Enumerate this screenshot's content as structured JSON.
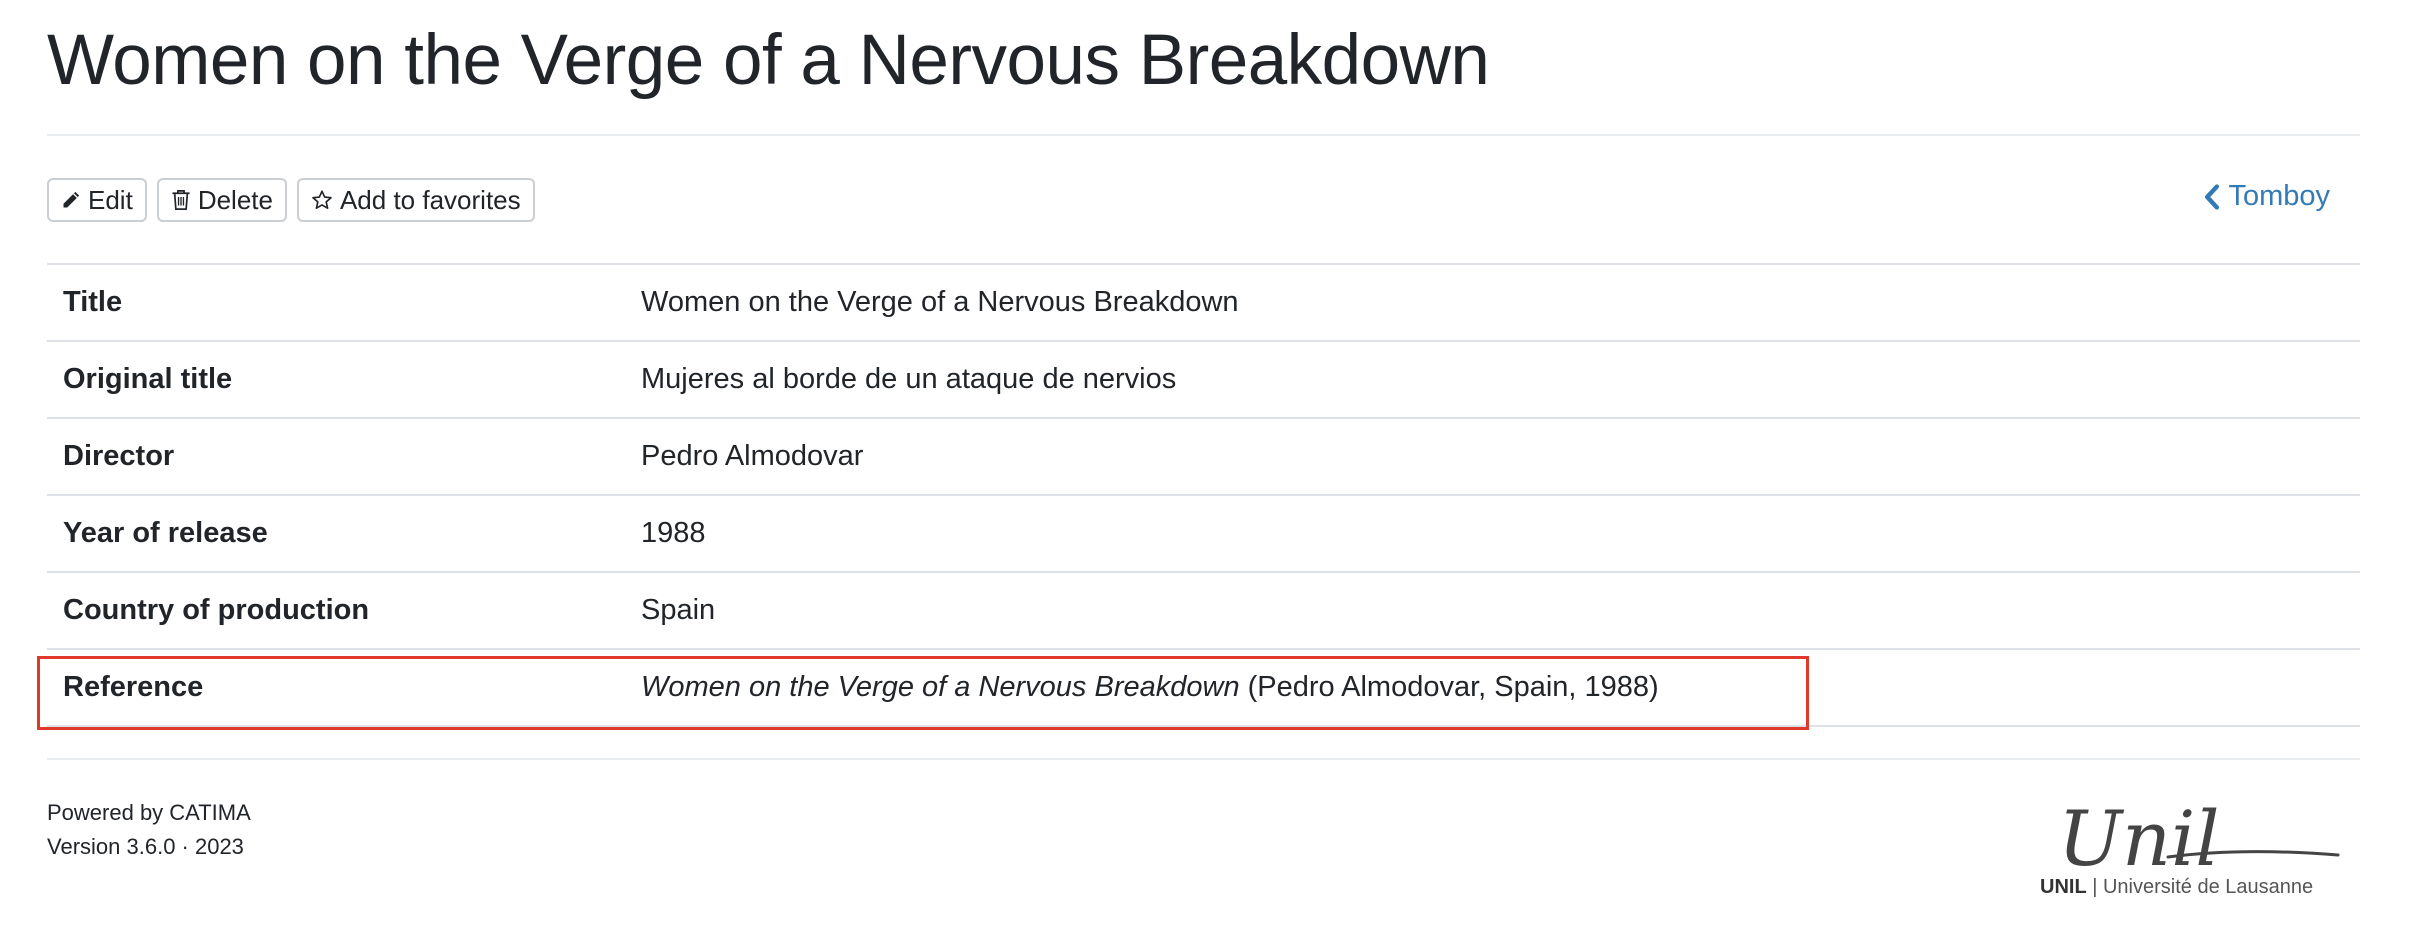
{
  "page": {
    "title": "Women on the Verge of a Nervous Breakdown"
  },
  "toolbar": {
    "edit_label": "Edit",
    "delete_label": "Delete",
    "favorites_label": "Add to favorites",
    "edit_icon": "pencil-icon",
    "delete_icon": "trash-icon",
    "favorites_icon": "star-icon"
  },
  "back_link": {
    "label": "Tomboy",
    "icon": "chevron-left-icon"
  },
  "details": [
    {
      "label": "Title",
      "value": "Women on the Verge of a Nervous Breakdown"
    },
    {
      "label": "Original title",
      "value": "Mujeres al borde de un ataque de nervios"
    },
    {
      "label": "Director",
      "value": "Pedro Almodovar"
    },
    {
      "label": "Year of release",
      "value": "1988"
    },
    {
      "label": "Country of production",
      "value": "Spain"
    }
  ],
  "reference": {
    "label": "Reference",
    "title_italic": "Women on the Verge of a Nervous Breakdown",
    "suffix": " (Pedro Almodovar, Spain, 1988)"
  },
  "footer": {
    "powered_by": "Powered by CATIMA",
    "version": "Version 3.6.0 · 2023",
    "logo_wordmark": "Unil",
    "logo_caption_bold": "UNIL",
    "logo_caption_rest": " | Université de Lausanne"
  },
  "colors": {
    "link": "#337ab7",
    "highlight": "#e0382a",
    "text": "#212529"
  }
}
